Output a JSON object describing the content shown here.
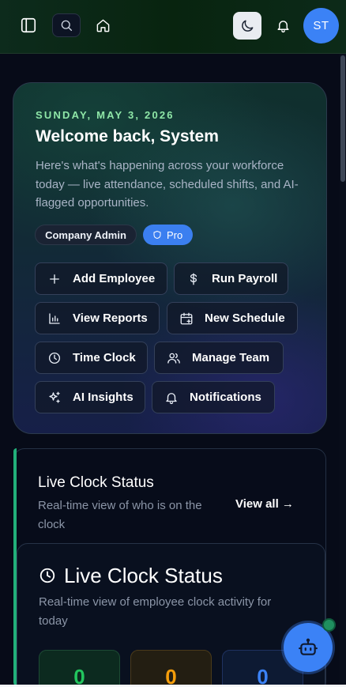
{
  "topbar": {
    "avatar_initials": "ST"
  },
  "hero": {
    "date": "SUNDAY, MAY 3, 2026",
    "title": "Welcome back, System",
    "subtitle": "Here's what's happening across your workforce today — live attendance, scheduled shifts, and AI-flagged opportunities.",
    "badges": {
      "role": "Company Admin",
      "plan": "Pro"
    },
    "actions": [
      {
        "label": "Add Employee",
        "icon": "plus-icon"
      },
      {
        "label": "Run Payroll",
        "icon": "dollar-icon"
      },
      {
        "label": "View Reports",
        "icon": "bar-chart-icon"
      },
      {
        "label": "New Schedule",
        "icon": "calendar-plus-icon"
      },
      {
        "label": "Time Clock",
        "icon": "clock-icon"
      },
      {
        "label": "Manage Team",
        "icon": "users-icon"
      },
      {
        "label": "AI Insights",
        "icon": "sparkles-icon"
      },
      {
        "label": "Notifications",
        "icon": "bell-icon"
      }
    ]
  },
  "live_clock_section": {
    "title": "Live Clock Status",
    "subtitle": "Real-time view of who is on the clock",
    "view_all": "View all →"
  },
  "live_clock_card": {
    "title": "Live Clock Status",
    "subtitle": "Real-time view of employee clock activity for today",
    "stats": [
      {
        "value": "0",
        "color": "#22c55e"
      },
      {
        "value": "0",
        "color": "#f59e0b"
      },
      {
        "value": "0",
        "color": "#3b82f6"
      }
    ]
  },
  "colors": {
    "accent": "#3b82f6",
    "topbar_bg": "#08240f",
    "date_green": "#8ee6a7"
  }
}
